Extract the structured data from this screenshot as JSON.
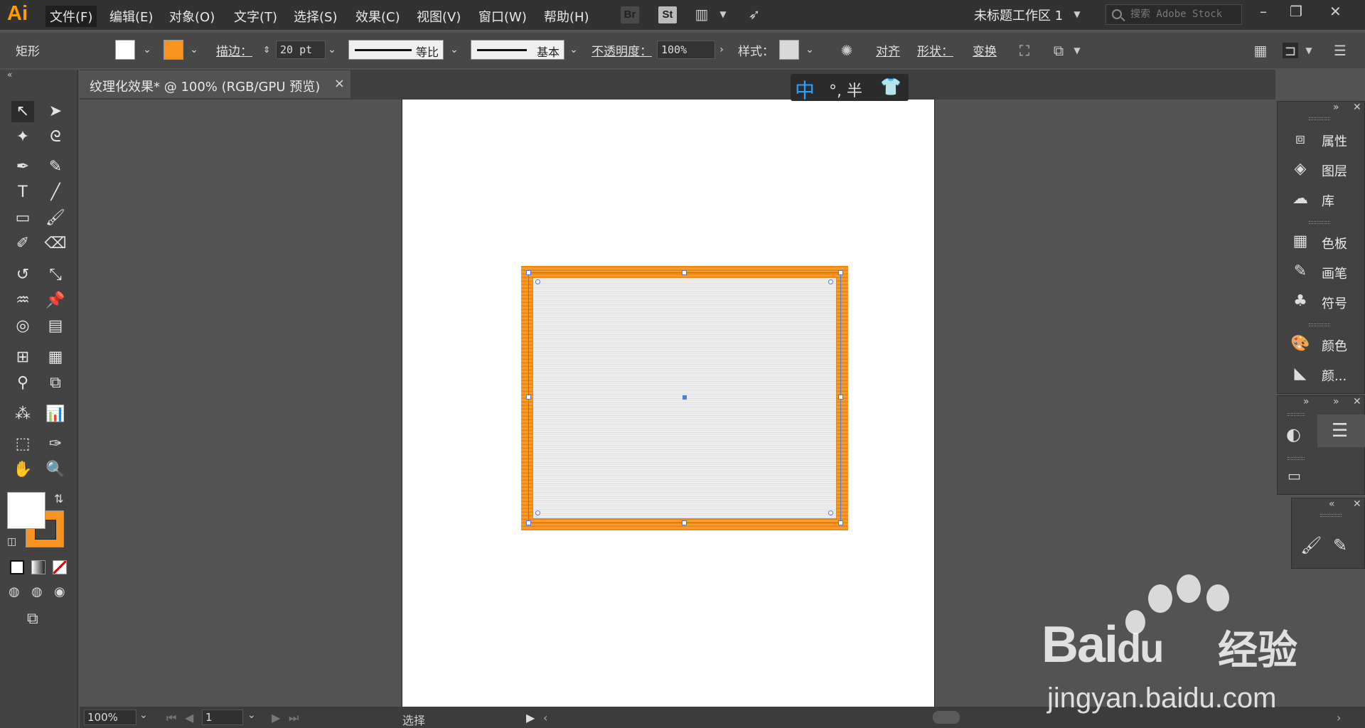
{
  "menubar": {
    "logo": "Ai",
    "items": [
      "文件(F)",
      "编辑(E)",
      "对象(O)",
      "文字(T)",
      "选择(S)",
      "效果(C)",
      "视图(V)",
      "窗口(W)",
      "帮助(H)"
    ],
    "app_icons": [
      "Br",
      "St"
    ],
    "workspace": "未标题工作区 1",
    "search_placeholder": "搜索 Adobe Stock"
  },
  "controlbar": {
    "shape_label": "矩形",
    "fill_color": "#ffffff",
    "stroke_color": "#f7931e",
    "stroke_label": "描边：",
    "stroke_weight": "20 pt",
    "profile_label": "等比",
    "brush_label": "基本",
    "opacity_label": "不透明度：",
    "opacity_value": "100%",
    "style_label": "样式：",
    "align_label": "对齐",
    "shape_props_label": "形状：",
    "transform_label": "变换"
  },
  "document": {
    "tab_title": "纹理化效果* @ 100% (RGB/GPU 预览)"
  },
  "ime": {
    "mode": "中",
    "punct": "°, 半"
  },
  "panels": {
    "group1": [
      "属性",
      "图层",
      "库"
    ],
    "group2": [
      "色板",
      "画笔",
      "符号"
    ],
    "group3": [
      "颜色",
      "颜..."
    ]
  },
  "statusbar": {
    "zoom": "100%",
    "page": "1",
    "tool": "选择"
  },
  "watermark": {
    "brand": "Bai",
    "brand2": "du",
    "cn": "经验",
    "url": "jingyan.baidu.com"
  }
}
